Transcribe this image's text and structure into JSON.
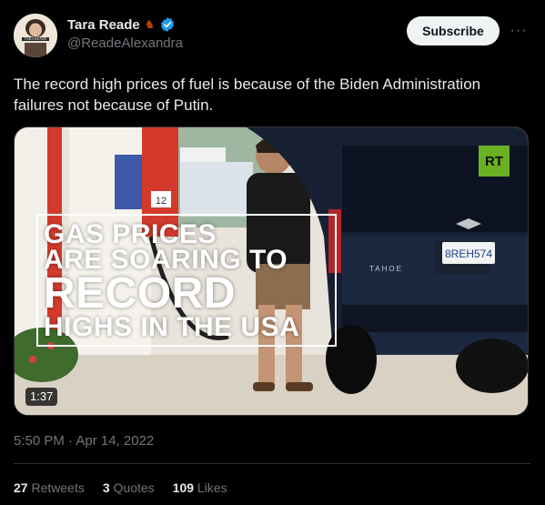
{
  "author": {
    "display_name": "Tara Reade",
    "emoji_icon": "horse-icon",
    "verified_icon": "verified-badge-icon",
    "handle": "@ReadeAlexandra",
    "avatar_text": "TARA READE"
  },
  "actions": {
    "subscribe_label": "Subscribe",
    "more_label": "···"
  },
  "tweet": {
    "text": "The record high prices of fuel is because of the Biden Administration failures not because of Putin.",
    "timestamp": "5:50 PM · Apr 14, 2022"
  },
  "media": {
    "badge": "RT",
    "headline_line1": "GAS PRICES",
    "headline_line2": "ARE SOARING TO",
    "headline_line3": "RECORD",
    "headline_line4": "HIGHS IN THE USA",
    "duration": "1:37",
    "plate": "8REH574",
    "vehicle_badge": "TAHOE",
    "pump_number": "12"
  },
  "stats": {
    "retweets_count": "27",
    "retweets_label": "Retweets",
    "quotes_count": "3",
    "quotes_label": "Quotes",
    "likes_count": "109",
    "likes_label": "Likes"
  },
  "colors": {
    "background": "#000000",
    "text_primary": "#e7e9ea",
    "text_secondary": "#71767b",
    "verified": "#1d9bf0",
    "rt_green": "#6ab023"
  }
}
